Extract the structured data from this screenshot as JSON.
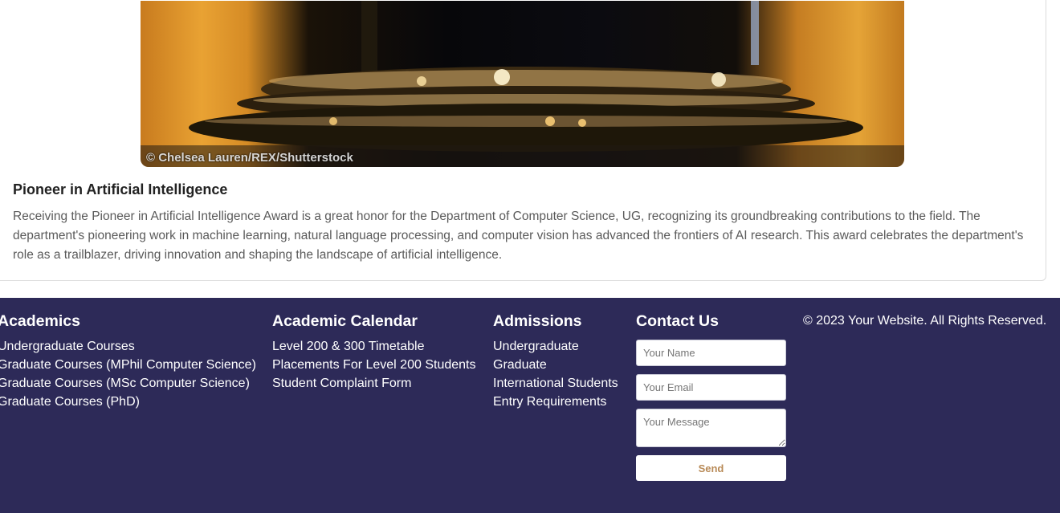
{
  "article": {
    "image_credit": "© Chelsea Lauren/REX/Shutterstock",
    "title": "Pioneer in Artificial Intelligence",
    "body": "Receiving the Pioneer in Artificial Intelligence Award is a great honor for the Department of Computer Science, UG, recognizing its groundbreaking contributions to the field. The department's pioneering work in machine learning, natural language processing, and computer vision has advanced the frontiers of AI research. This award celebrates the department's role as a trailblazer, driving innovation and shaping the landscape of artificial intelligence."
  },
  "footer": {
    "academics": {
      "heading": "Academics",
      "links": [
        "Undergraduate Courses",
        "Graduate Courses (MPhil Computer Science)",
        "Graduate Courses (MSc Computer Science)",
        "Graduate Courses (PhD)"
      ]
    },
    "calendar": {
      "heading": "Academic Calendar",
      "links": [
        "Level 200 & 300 Timetable",
        "Placements For Level 200 Students",
        "Student Complaint Form"
      ]
    },
    "admissions": {
      "heading": "Admissions",
      "links": [
        "Undergraduate",
        "Graduate",
        "International Students",
        "Entry Requirements"
      ]
    },
    "contact": {
      "heading": "Contact Us",
      "name_placeholder": "Your Name",
      "email_placeholder": "Your Email",
      "message_placeholder": "Your Message",
      "send_label": "Send"
    },
    "copyright": "© 2023 Your Website. All Rights Reserved."
  },
  "colors": {
    "footer_bg": "#2d2a58",
    "send_text": "#b88a57"
  }
}
